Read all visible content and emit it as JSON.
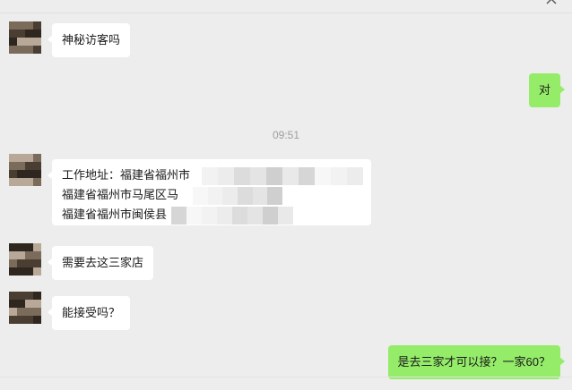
{
  "messages": [
    {
      "side": "left",
      "text": "神秘访客吗"
    },
    {
      "side": "right",
      "text": "对"
    },
    {
      "side": "time",
      "text": "09:51"
    },
    {
      "side": "left",
      "lines": [
        "工作地址：福建省福州市",
        "福建省福州市马尾区马",
        "福建省福州市闽侯县"
      ]
    },
    {
      "side": "left",
      "text": "需要去这三家店"
    },
    {
      "side": "left",
      "text": "能接受吗？"
    },
    {
      "side": "right",
      "text": "是去三家才可以接？一家60？"
    }
  ],
  "colors": {
    "background": "#ededed",
    "incoming_bubble": "#ffffff",
    "outgoing_bubble": "#95ec69",
    "timestamp": "#9e9e9e"
  },
  "icons": [
    "avatar-pixelated",
    "more-icon"
  ]
}
